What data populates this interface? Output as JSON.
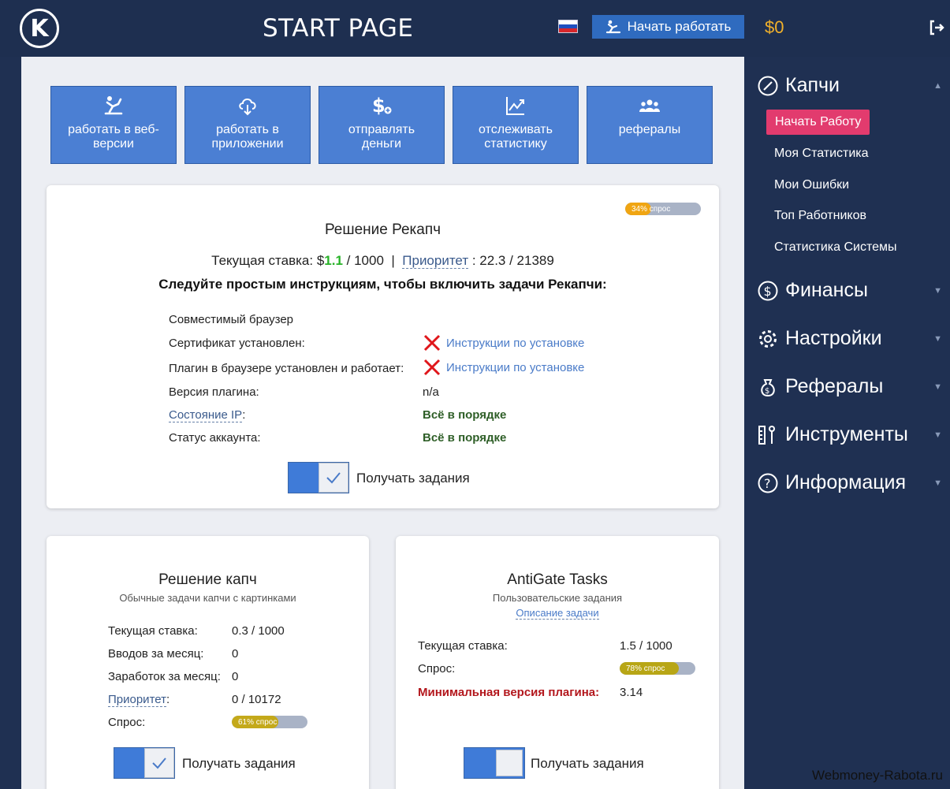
{
  "header": {
    "logo_letter": "K",
    "title": "START PAGE",
    "start_button": "Начать работать",
    "balance": "$0"
  },
  "tiles": [
    {
      "label": "работать в веб-версии",
      "icon": "worker-icon"
    },
    {
      "label": "работать в приложении",
      "icon": "cloud-download-icon"
    },
    {
      "label": "отправлять деньги",
      "icon": "dollar-icon"
    },
    {
      "label": "отслеживать статистику",
      "icon": "chart-icon"
    },
    {
      "label": "рефералы",
      "icon": "users-icon"
    }
  ],
  "recaptcha": {
    "demand": "34% спрос",
    "demand_value": 34,
    "title": "Решение Рекапч",
    "rate_label": "Текущая ставка: $",
    "rate_value": "1.1",
    "rate_suffix": " / 1000",
    "separator": "|",
    "priority_label": "Приоритет",
    "priority_value": " : 22.3 / 21389",
    "instructions": "Следуйте простым инструкциям, чтобы включить задачи Рекапчи:",
    "rows": [
      {
        "label": "Совместимый браузер",
        "value": ""
      },
      {
        "label": "Сертификат установлен:",
        "value": "Инструкции по установке"
      },
      {
        "label": "Плагин в браузере установлен и работает:",
        "value": "Инструкции по установке"
      },
      {
        "label": "Версия плагина:",
        "value": "n/a"
      },
      {
        "label": "Состояние IP",
        "label_suffix": ":",
        "value": "Всё в порядке"
      },
      {
        "label": "Статус аккаунта:",
        "value": "Всё в порядке"
      }
    ],
    "toggle_label": "Получать задания"
  },
  "captcha": {
    "title": "Решение капч",
    "subtitle": "Обычные задачи капчи с картинками",
    "rows": [
      {
        "label": "Текущая ставка:",
        "value": "0.3 / 1000"
      },
      {
        "label": "Вводов за месяц:",
        "value": "0"
      },
      {
        "label": "Заработок за месяц:",
        "value": "0"
      },
      {
        "label": "Приоритет",
        "label_suffix": ":",
        "value": "0 / 10172"
      },
      {
        "label": "Спрос:",
        "value": ""
      }
    ],
    "demand": "61% спрос",
    "demand_value": 61,
    "toggle_label": "Получать задания"
  },
  "antigate": {
    "title": "AntiGate Tasks",
    "subtitle": "Пользовательские задания",
    "description_link": "Описание задачи",
    "rows": [
      {
        "label": "Текущая ставка:",
        "value": "1.5 / 1000"
      },
      {
        "label": "Спрос:",
        "value": ""
      },
      {
        "label": "Минимальная версия плагина:",
        "value": "3.14"
      }
    ],
    "demand": "78% спрос",
    "demand_value": 78,
    "toggle_label": "Получать задания"
  },
  "sidebar": {
    "captcha_section": "Капчи",
    "active_item": "Начать Работу",
    "sub_items": [
      "Моя Статистика",
      "Мои Ошибки",
      "Топ Работников",
      "Статистика Системы"
    ],
    "sections": [
      "Финансы",
      "Настройки",
      "Рефералы",
      "Инструменты",
      "Информация"
    ]
  },
  "watermark": "Webmoney-Rabota.ru",
  "colors": {
    "header_bg": "#1e2f50",
    "tile_bg": "#4b7fd3",
    "accent_pink": "#e23b6e",
    "balance": "#f1b12b",
    "ok_green": "#2f5f28",
    "error_red": "#b3171d"
  }
}
